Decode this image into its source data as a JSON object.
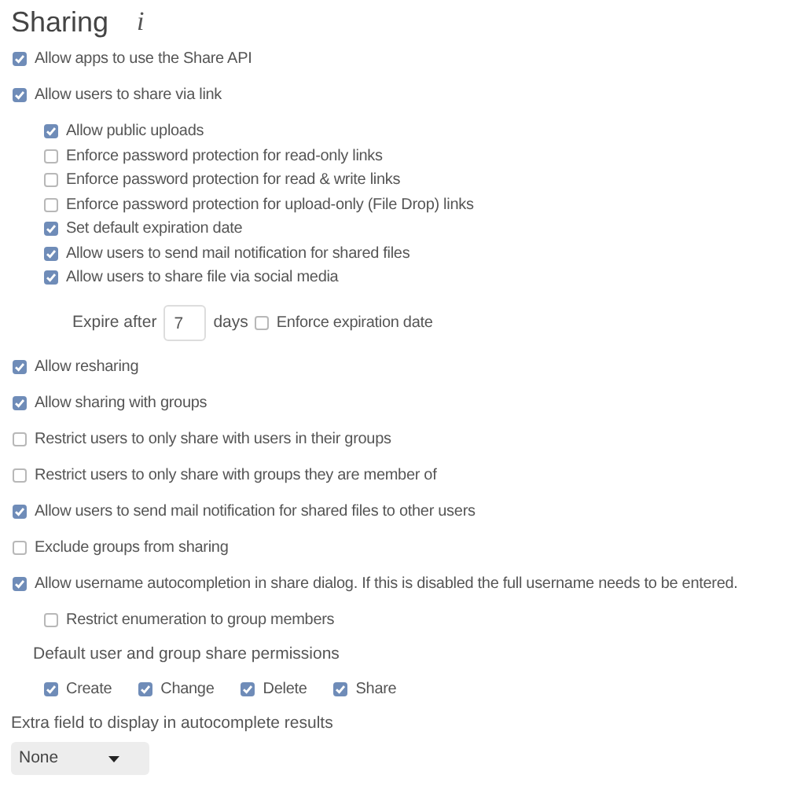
{
  "title": "Sharing",
  "info_icon": "i",
  "settings": [
    {
      "kind": "checkbox",
      "label": "Allow apps to use the Share API",
      "checked": true
    },
    {
      "kind": "checkbox",
      "label": "Allow users to share via link",
      "checked": true,
      "children": [
        {
          "label": "Allow public uploads",
          "checked": true
        },
        {
          "label": "Enforce password protection for read-only links",
          "checked": false
        },
        {
          "label": "Enforce password protection for read & write links",
          "checked": false
        },
        {
          "label": "Enforce password protection for upload-only (File Drop) links",
          "checked": false
        },
        {
          "label": "Set default expiration date",
          "checked": true
        },
        {
          "label": "Allow users to send mail notification for shared files",
          "checked": true
        },
        {
          "label": "Allow users to share file via social media",
          "checked": true
        }
      ],
      "expiry": {
        "label": "Expire after",
        "value": "7",
        "unit": "days",
        "enforce": {
          "label": "Enforce expiration date",
          "checked": false
        }
      }
    },
    {
      "kind": "checkbox",
      "label": "Allow resharing",
      "checked": true
    },
    {
      "kind": "checkbox",
      "label": "Allow sharing with groups",
      "checked": true
    },
    {
      "kind": "checkbox",
      "label": "Restrict users to only share with users in their groups",
      "checked": false
    },
    {
      "kind": "checkbox",
      "label": "Restrict users to only share with groups they are member of",
      "checked": false
    },
    {
      "kind": "checkbox",
      "label": "Allow users to send mail notification for shared files to other users",
      "checked": true
    },
    {
      "kind": "checkbox",
      "label": "Exclude groups from sharing",
      "checked": false
    },
    {
      "kind": "checkbox",
      "label": "Allow username autocompletion in share dialog. If this is disabled the full username needs to be entered.",
      "checked": true,
      "children": [
        {
          "label": "Restrict enumeration to group members",
          "checked": false
        }
      ]
    },
    {
      "kind": "permissions",
      "label": "Default user and group share permissions",
      "options": [
        {
          "label": "Create",
          "checked": true
        },
        {
          "label": "Change",
          "checked": true
        },
        {
          "label": "Delete",
          "checked": true
        },
        {
          "label": "Share",
          "checked": true
        }
      ]
    },
    {
      "kind": "select",
      "label": "Extra field to display in autocomplete results",
      "value": "None"
    }
  ]
}
